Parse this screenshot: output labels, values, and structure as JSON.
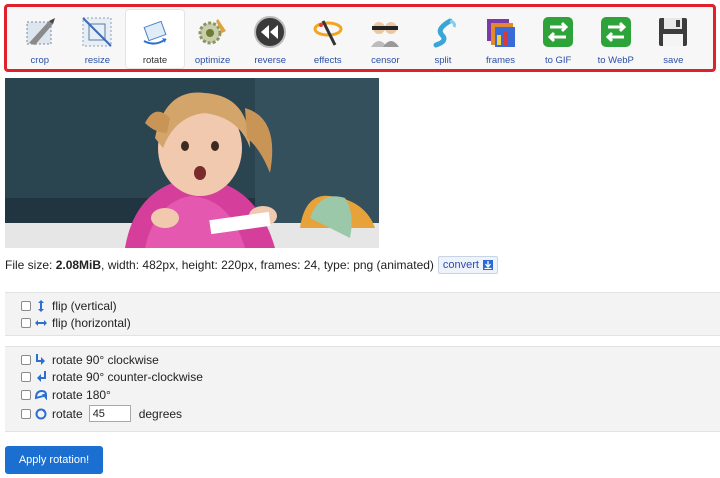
{
  "toolbar": {
    "tools": [
      {
        "label": "crop",
        "icon": "crop-icon"
      },
      {
        "label": "resize",
        "icon": "resize-icon"
      },
      {
        "label": "rotate",
        "icon": "rotate-icon"
      },
      {
        "label": "optimize",
        "icon": "optimize-icon"
      },
      {
        "label": "reverse",
        "icon": "reverse-icon"
      },
      {
        "label": "effects",
        "icon": "effects-icon"
      },
      {
        "label": "censor",
        "icon": "censor-icon"
      },
      {
        "label": "split",
        "icon": "split-icon"
      },
      {
        "label": "frames",
        "icon": "frames-icon"
      },
      {
        "label": "to GIF",
        "icon": "to-gif-icon"
      },
      {
        "label": "to WebP",
        "icon": "to-webp-icon"
      },
      {
        "label": "save",
        "icon": "save-icon"
      }
    ],
    "active": "rotate"
  },
  "file_info": {
    "prefix": "File size: ",
    "size": "2.08MiB",
    "details": ", width: 482px, height: 220px, frames: 24, type: png (animated)",
    "convert_label": "convert"
  },
  "flip_options": {
    "vertical": "flip (vertical)",
    "horizontal": "flip (horizontal)"
  },
  "rotate_options": {
    "cw": "rotate 90° clockwise",
    "ccw": "rotate 90° counter-clockwise",
    "r180": "rotate 180°",
    "custom_label": "rotate",
    "custom_value": "45",
    "custom_unit": "degrees"
  },
  "apply_label": "Apply rotation!",
  "colors": {
    "accent": "#1a6fd1",
    "toolbar_border": "#e0202b",
    "link": "#2a4fa8"
  }
}
